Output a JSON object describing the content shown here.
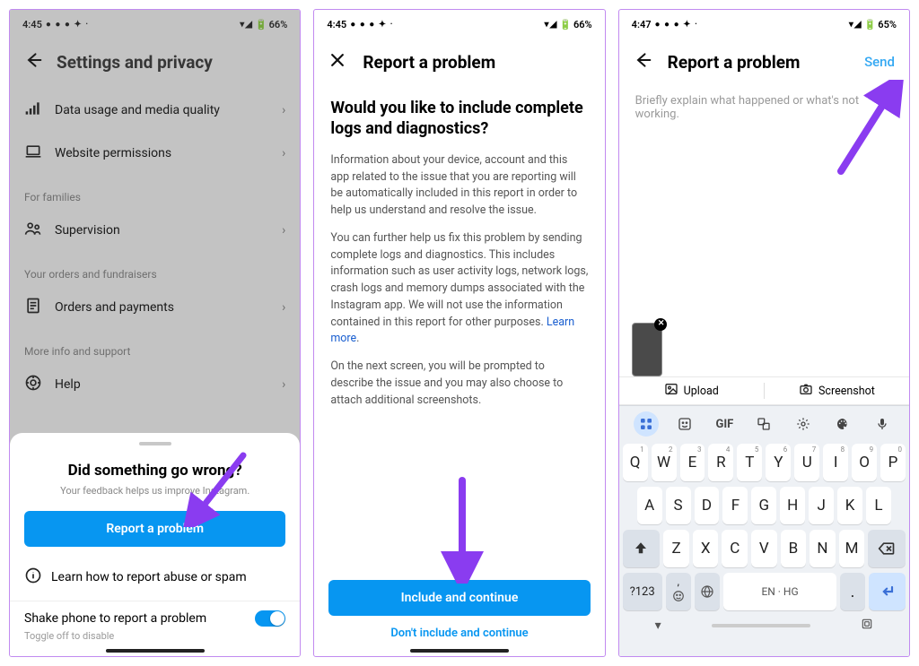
{
  "screen1": {
    "time": "4:45",
    "battery": "66%",
    "header_title": "Settings and privacy",
    "rows": {
      "data_usage": "Data usage and media quality",
      "website_perm": "Website permissions",
      "supervision": "Supervision",
      "orders": "Orders and payments",
      "help": "Help"
    },
    "sections": {
      "families": "For families",
      "orders": "Your orders and fundraisers",
      "more_info": "More info and support"
    },
    "sheet": {
      "title": "Did something go wrong?",
      "subtitle": "Your feedback helps us improve Instagram.",
      "report_btn": "Report a problem",
      "learn_abuse": "Learn how to report abuse or spam",
      "shake_label": "Shake phone to report a problem",
      "shake_sub": "Toggle off to disable"
    }
  },
  "screen2": {
    "time": "4:45",
    "battery": "66%",
    "header_title": "Report a problem",
    "question": "Would you like to include complete logs and diagnostics?",
    "para1": "Information about your device, account and this app related to the issue that you are reporting will be automatically included in this report in order to help us understand and resolve the issue.",
    "para2": "You can further help us fix this problem by sending complete logs and diagnostics. This includes information such as user activity logs, network logs, crash logs and memory dumps associated with the Instagram app. We will not use the information contained in this report for other purposes. ",
    "learn_more": "Learn more",
    "para3": "On the next screen, you will be prompted to describe the issue and you may also choose to attach additional screenshots.",
    "include_btn": "Include and continue",
    "skip_link": "Don't include and continue"
  },
  "screen3": {
    "time": "4:47",
    "battery": "65%",
    "header_title": "Report a problem",
    "send": "Send",
    "placeholder": "Briefly explain what happened or what's not working.",
    "upload": "Upload",
    "screenshot": "Screenshot",
    "gif_label": "GIF",
    "space_label": "EN · HG",
    "sym_label": "?123",
    "row1_letters": [
      "Q",
      "W",
      "E",
      "R",
      "T",
      "Y",
      "U",
      "I",
      "O",
      "P"
    ],
    "row1_super": [
      "1",
      "2",
      "3",
      "4",
      "5",
      "6",
      "7",
      "8",
      "9",
      "0"
    ],
    "row2_letters": [
      "A",
      "S",
      "D",
      "F",
      "G",
      "H",
      "J",
      "K",
      "L"
    ],
    "row3_letters": [
      "Z",
      "X",
      "C",
      "V",
      "B",
      "N",
      "M"
    ]
  }
}
